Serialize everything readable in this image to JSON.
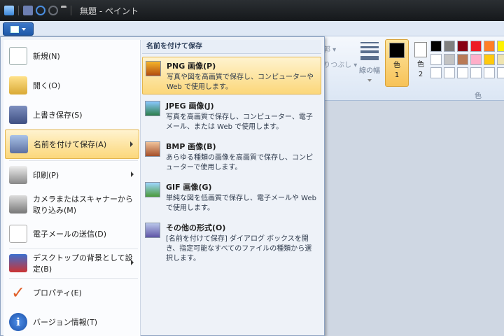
{
  "window": {
    "title": "無題 - ペイント"
  },
  "ribbon": {
    "fragment_top": "郭 ▾",
    "fragment_bottom": "りつぶし ▾",
    "line_width_label": "線の幅",
    "color1_label": "色\n1",
    "color2_label": "色\n2",
    "colors_group_label": "色",
    "color1_value": "#000000",
    "color2_value": "#ffffff",
    "palette": [
      "#000000",
      "#7f7f7f",
      "#880015",
      "#ed1c24",
      "#ff7f27",
      "#fff200",
      "#ffffff",
      "#c3c3c3",
      "#b97a57",
      "#ffaec9",
      "#ffc90e",
      "#efe4b0",
      "#ffffff",
      "#ffffff",
      "#ffffff",
      "#ffffff",
      "#ffffff",
      "#ffffff"
    ]
  },
  "app_menu": {
    "items": [
      {
        "label": "新規(N)"
      },
      {
        "label": "開く(O)"
      },
      {
        "label": "上書き保存(S)"
      },
      {
        "label": "名前を付けて保存(A)"
      },
      {
        "label": "印刷(P)"
      },
      {
        "label": "カメラまたはスキャナーから取り込み(M)"
      },
      {
        "label": "電子メールの送信(D)"
      },
      {
        "label": "デスクトップの背景として設定(B)"
      },
      {
        "label": "プロパティ(E)"
      },
      {
        "label": "バージョン情報(T)"
      }
    ],
    "submenu": {
      "header": "名前を付けて保存",
      "items": [
        {
          "title": "PNG 画像(P)",
          "desc": "写真や図を高画質で保存し、コンピューターや Web で使用します。"
        },
        {
          "title": "JPEG 画像(J)",
          "desc": "写真を高画質で保存し、コンピューター、電子メール、または Web で使用します。"
        },
        {
          "title": "BMP 画像(B)",
          "desc": "あらゆる種類の画像を高画質で保存し、コンピューターで使用します。"
        },
        {
          "title": "GIF 画像(G)",
          "desc": "単純な図を低画質で保存し、電子メールや Web で使用します。"
        },
        {
          "title": "その他の形式(O)",
          "desc": "[名前を付けて保存] ダイアログ ボックスを開き、指定可能なすべてのファイルの種類から選択します。"
        }
      ]
    }
  }
}
